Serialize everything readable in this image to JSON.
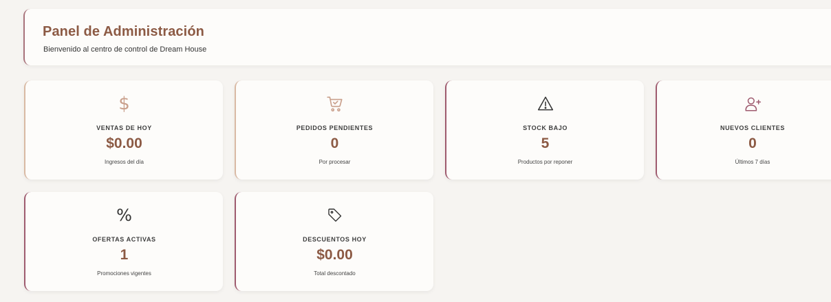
{
  "header": {
    "title": "Panel de Administración",
    "subtitle": "Bienvenido al centro de control de Dream House"
  },
  "cards": [
    {
      "icon": "dollar-icon",
      "icon_glyph": "$",
      "label": "VENTAS DE HOY",
      "value": "$0.00",
      "sub": "Ingresos del día"
    },
    {
      "icon": "shopping-cart-icon",
      "label": "PEDIDOS PENDIENTES",
      "value": "0",
      "sub": "Por procesar"
    },
    {
      "icon": "warning-icon",
      "label": "STOCK BAJO",
      "value": "5",
      "sub": "Productos por reponer"
    },
    {
      "icon": "user-plus-icon",
      "label": "NUEVOS CLIENTES",
      "value": "0",
      "sub": "Últimos 7 días"
    },
    {
      "icon": "percent-icon",
      "icon_glyph": "%",
      "label": "OFERTAS ACTIVAS",
      "value": "1",
      "sub": "Promociones vigentes"
    },
    {
      "icon": "tag-icon",
      "label": "DESCUENTOS HOY",
      "value": "$0.00",
      "sub": "Total descontado"
    }
  ],
  "colors": {
    "accent_brown": "#8c5a44",
    "accent_plum": "#9e5a6e",
    "accent_tan": "#d9b9a3",
    "icon_tan": "#c99f8b"
  }
}
